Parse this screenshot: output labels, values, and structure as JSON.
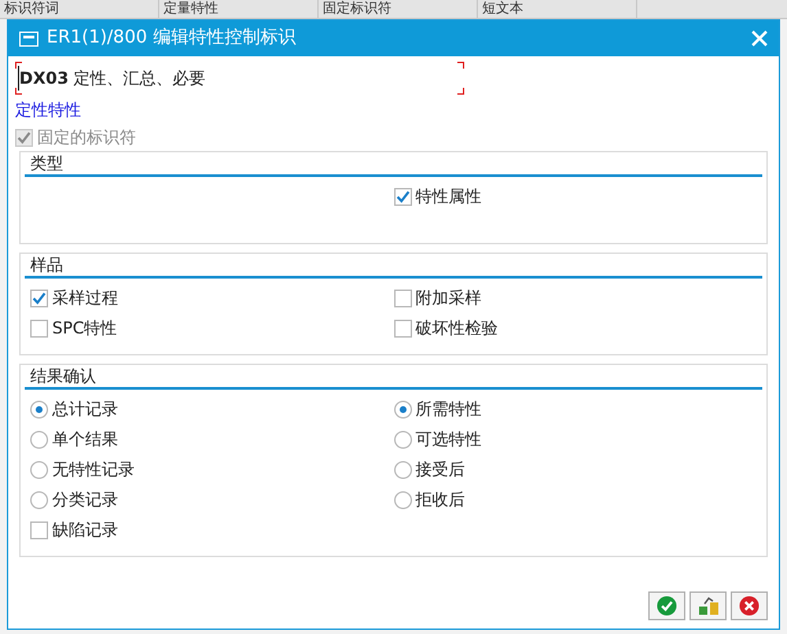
{
  "background_table": {
    "columns": [
      "标识符词",
      "定量特性",
      "固定标识符",
      "短文本"
    ]
  },
  "dialog": {
    "title": "ER1(1)/800 编辑特性控制标识",
    "field": {
      "value": "**DX03** 定性、汇总、必要"
    },
    "link": "定性特性",
    "fixed_identifier": {
      "label": "固定的标识符",
      "checked": true,
      "disabled": true
    },
    "groups": [
      {
        "title": "类型",
        "right": [
          {
            "kind": "checkbox",
            "label": "特性属性",
            "checked": true
          }
        ]
      },
      {
        "title": "样品",
        "left": [
          {
            "kind": "checkbox",
            "label": "采样过程",
            "checked": true
          },
          {
            "kind": "checkbox",
            "label": "SPC特性",
            "checked": false
          }
        ],
        "right": [
          {
            "kind": "checkbox",
            "label": "附加采样",
            "checked": false
          },
          {
            "kind": "checkbox",
            "label": "破坏性检验",
            "checked": false
          }
        ]
      },
      {
        "title": "结果确认",
        "left": [
          {
            "kind": "radio",
            "label": "总计记录",
            "selected": true
          },
          {
            "kind": "radio",
            "label": "单个结果",
            "selected": false
          },
          {
            "kind": "radio",
            "label": "无特性记录",
            "selected": false
          },
          {
            "kind": "radio",
            "label": "分类记录",
            "selected": false
          },
          {
            "kind": "checkbox",
            "label": "缺陷记录",
            "checked": false
          }
        ],
        "right": [
          {
            "kind": "radio",
            "label": "所需特性",
            "selected": true
          },
          {
            "kind": "radio",
            "label": "可选特性",
            "selected": false
          },
          {
            "kind": "radio",
            "label": "接受后",
            "selected": false
          },
          {
            "kind": "radio",
            "label": "拒收后",
            "selected": false
          }
        ]
      }
    ],
    "buttons": [
      {
        "kind": "confirm"
      },
      {
        "kind": "transfer"
      },
      {
        "kind": "cancel"
      }
    ]
  }
}
